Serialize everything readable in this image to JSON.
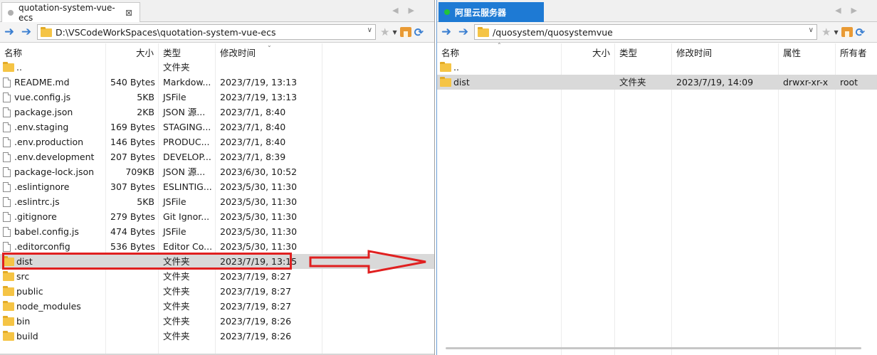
{
  "left": {
    "tab": {
      "title": "quotation-system-vue-ecs",
      "close": "⊠"
    },
    "scroll_arrows": "◀▶",
    "path": "D:\\VSCodeWorkSpaces\\quotation-system-vue-ecs",
    "columns": {
      "name": "名称",
      "size": "大小",
      "type": "类型",
      "mtime": "修改时间"
    },
    "rows": [
      {
        "icon": "folder",
        "name": "..",
        "size": "",
        "type": "文件夹",
        "mtime": ""
      },
      {
        "icon": "file",
        "name": "README.md",
        "size": "540 Bytes",
        "type": "Markdow...",
        "mtime": "2023/7/19, 13:13"
      },
      {
        "icon": "file",
        "name": "vue.config.js",
        "size": "5KB",
        "type": "JSFile",
        "mtime": "2023/7/19, 13:13"
      },
      {
        "icon": "file",
        "name": "package.json",
        "size": "2KB",
        "type": "JSON 源...",
        "mtime": "2023/7/1, 8:40"
      },
      {
        "icon": "file",
        "name": ".env.staging",
        "size": "169 Bytes",
        "type": "STAGING...",
        "mtime": "2023/7/1, 8:40"
      },
      {
        "icon": "file",
        "name": ".env.production",
        "size": "146 Bytes",
        "type": "PRODUC...",
        "mtime": "2023/7/1, 8:40"
      },
      {
        "icon": "file",
        "name": ".env.development",
        "size": "207 Bytes",
        "type": "DEVELOP...",
        "mtime": "2023/7/1, 8:39"
      },
      {
        "icon": "file",
        "name": "package-lock.json",
        "size": "709KB",
        "type": "JSON 源...",
        "mtime": "2023/6/30, 10:52"
      },
      {
        "icon": "file",
        "name": ".eslintignore",
        "size": "307 Bytes",
        "type": "ESLINTIG...",
        "mtime": "2023/5/30, 11:30"
      },
      {
        "icon": "file",
        "name": ".eslintrc.js",
        "size": "5KB",
        "type": "JSFile",
        "mtime": "2023/5/30, 11:30"
      },
      {
        "icon": "file",
        "name": ".gitignore",
        "size": "279 Bytes",
        "type": "Git Ignor...",
        "mtime": "2023/5/30, 11:30"
      },
      {
        "icon": "file",
        "name": "babel.config.js",
        "size": "474 Bytes",
        "type": "JSFile",
        "mtime": "2023/5/30, 11:30"
      },
      {
        "icon": "file",
        "name": ".editorconfig",
        "size": "536 Bytes",
        "type": "Editor Co...",
        "mtime": "2023/5/30, 11:30"
      },
      {
        "icon": "folder",
        "name": "dist",
        "size": "",
        "type": "文件夹",
        "mtime": "2023/7/19, 13:15",
        "selected": true
      },
      {
        "icon": "folder",
        "name": "src",
        "size": "",
        "type": "文件夹",
        "mtime": "2023/7/19, 8:27"
      },
      {
        "icon": "folder",
        "name": "public",
        "size": "",
        "type": "文件夹",
        "mtime": "2023/7/19, 8:27"
      },
      {
        "icon": "folder",
        "name": "node_modules",
        "size": "",
        "type": "文件夹",
        "mtime": "2023/7/19, 8:27"
      },
      {
        "icon": "folder",
        "name": "bin",
        "size": "",
        "type": "文件夹",
        "mtime": "2023/7/19, 8:26"
      },
      {
        "icon": "folder",
        "name": "build",
        "size": "",
        "type": "文件夹",
        "mtime": "2023/7/19, 8:26"
      }
    ]
  },
  "right": {
    "tab": {
      "title": "阿里云服务器"
    },
    "scroll_arrows": "◀▶",
    "path": "/quosystem/quosystemvue",
    "columns": {
      "name": "名称",
      "size": "大小",
      "type": "类型",
      "mtime": "修改时间",
      "attr": "属性",
      "owner": "所有者"
    },
    "rows": [
      {
        "icon": "folder",
        "name": "..",
        "size": "",
        "type": "",
        "mtime": "",
        "attr": "",
        "owner": ""
      },
      {
        "icon": "folder",
        "name": "dist",
        "size": "",
        "type": "文件夹",
        "mtime": "2023/7/19, 14:09",
        "attr": "drwxr-xr-x",
        "owner": "root",
        "selected": true
      }
    ]
  },
  "colors": {
    "highlight": "#e02020",
    "tab_active": "#1e7ad4",
    "selection": "#d9d9d9"
  }
}
